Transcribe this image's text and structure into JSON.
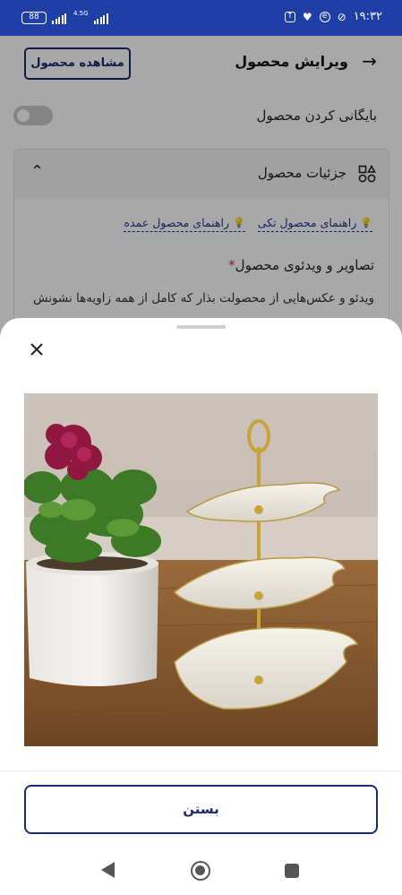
{
  "status_bar": {
    "battery": "88",
    "network": "4.5G",
    "time": "۱۹:۳۲"
  },
  "header": {
    "title": "ویرایش محصول",
    "view_product_label": "مشاهده محصول"
  },
  "archive": {
    "label": "بایگانی کردن محصول",
    "enabled": false
  },
  "details_section": {
    "title": "جزئیات محصول",
    "guide_single": "راهنمای محصول تکی",
    "guide_bulk": "راهنمای محصول عمده",
    "media_title": "تصاویر و ویدئوی محصول",
    "required_mark": "*",
    "media_description": "ویدئو و عکس‌هایی از محصولت بذار که کامل از همه زاویه‌ها نشونش"
  },
  "sheet": {
    "close_label": "بستن"
  },
  "colors": {
    "status_bar": "#1e3fa8",
    "accent": "#1a2a6c",
    "link": "#1d3a8a",
    "required": "#d32f2f"
  }
}
